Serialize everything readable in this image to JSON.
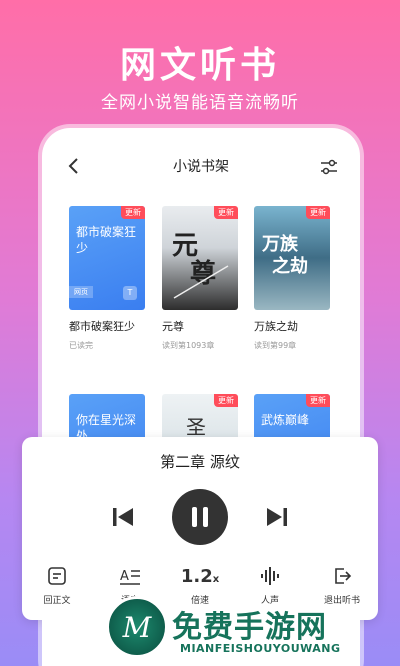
{
  "hero": {
    "title": "网文听书",
    "subtitle": "全网小说智能语音流畅听"
  },
  "topbar": {
    "title": "小说书架"
  },
  "books": [
    {
      "cover_text": "都市破案狂少",
      "badge": "更新",
      "web_tag": "网页",
      "t_tag": "T",
      "title": "都市破案狂少",
      "sub": "已读完"
    },
    {
      "badge": "更新",
      "title": "元尊",
      "sub": "读到第1093章"
    },
    {
      "badge": "更新",
      "title": "万族之劫",
      "sub": "读到第99章"
    },
    {
      "cover_text": "你在星光深处",
      "title": ""
    },
    {
      "badge": "更新",
      "title": ""
    },
    {
      "cover_text": "武炼巅峰",
      "badge": "更新",
      "title": ""
    }
  ],
  "player": {
    "chapter": "第二章 源纹",
    "speed": "1.2",
    "speed_unit": "x",
    "controls": [
      {
        "label": "回正文"
      },
      {
        "label": "语音"
      },
      {
        "label": "倍速"
      },
      {
        "label": "人声"
      },
      {
        "label": "退出听书"
      }
    ]
  },
  "watermark": {
    "brand": "免费手游网",
    "url": "MIANFEISHOUYOUWANG",
    "logo_letter": "M"
  }
}
